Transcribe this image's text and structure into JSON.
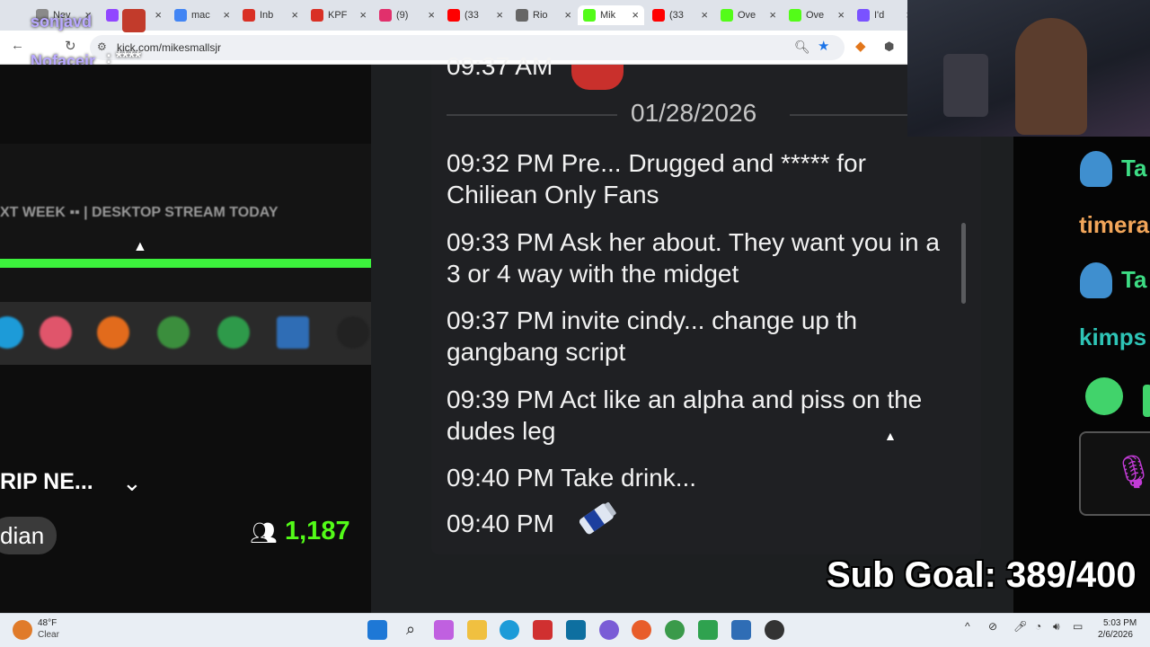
{
  "browser": {
    "tabs": [
      {
        "label": "Nev",
        "color": "#8a8a8a"
      },
      {
        "label": "",
        "color": "#9146ff"
      },
      {
        "label": "mac",
        "color": "#4285f4"
      },
      {
        "label": "Inb",
        "color": "#d93025"
      },
      {
        "label": "KPF",
        "color": "#d93025"
      },
      {
        "label": "(9)",
        "color": "#e1306c"
      },
      {
        "label": "(33",
        "color": "#ff0000"
      },
      {
        "label": "Rio",
        "color": "#666666"
      },
      {
        "label": "Mik",
        "color": "#53fc18"
      },
      {
        "label": "(33",
        "color": "#ff0000"
      },
      {
        "label": "Ove",
        "color": "#53fc18"
      },
      {
        "label": "Ove",
        "color": "#53fc18"
      },
      {
        "label": "I'd",
        "color": "#7a52ff"
      }
    ],
    "url": "kick.com/mikesmallsjr"
  },
  "overlay": {
    "name1": "sonjavd",
    "name2": "Nofacejr",
    "name2_suffix": ": ****"
  },
  "stream": {
    "banner": "XT WEEK ▪▪ | DESKTOP STREAM TODAY",
    "title_truncated": "RIP NE...",
    "category": "dian",
    "viewer_count": "1,187"
  },
  "chat": {
    "partial_time": "09:37 AM",
    "date": "01/28/2026",
    "messages": [
      {
        "text": "09:32 PM Pre... Drugged and ***** for Chiliean Only Fans"
      },
      {
        "text": "09:33 PM Ask her about. They want you in a 3 or 4 way with the midget"
      },
      {
        "text": "09:37 PM invite cindy... change up th gangbang script"
      },
      {
        "text": "09:39 PM Act like an alpha and piss on the dudes leg"
      },
      {
        "text": "09:40 PM Take drink..."
      },
      {
        "text": "09:40 PM"
      }
    ]
  },
  "right_chat": {
    "user1": "Ta",
    "user2": "timera",
    "user3": "Ta",
    "user4": "kimps",
    "user1_color": "#3ddc84",
    "user2_color": "#f2a65a",
    "user4_color": "#2ec4b6"
  },
  "sub_goal": "Sub Goal: 389/400",
  "taskbar": {
    "weather_temp": "48°F",
    "weather_desc": "Clear",
    "time": "5:03 PM",
    "date": "2/6/2026"
  }
}
